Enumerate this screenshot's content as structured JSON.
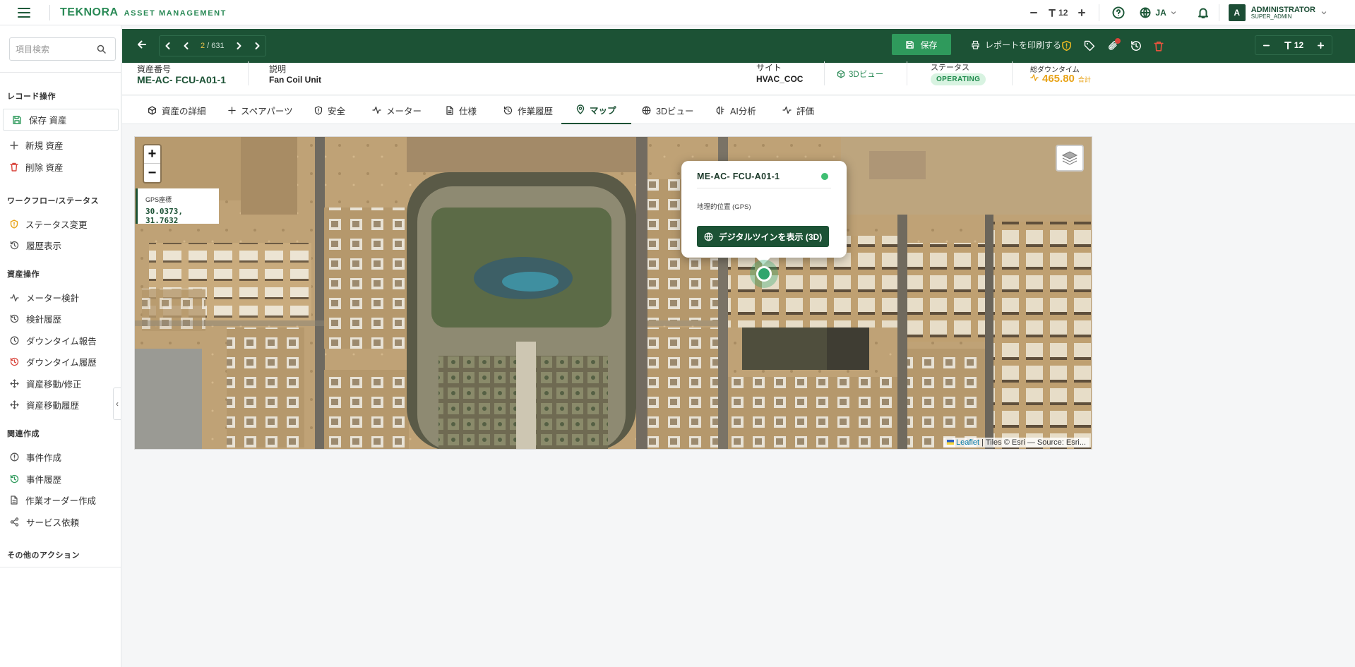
{
  "app": {
    "logo": "TEKNORA",
    "subtitle": "ASSET MANAGEMENT"
  },
  "topbar": {
    "font_size": "12",
    "lang": "JA",
    "user_initial": "A",
    "user_name": "ADMINISTRATOR",
    "user_role": "SUPER_ADMIN"
  },
  "sidebar": {
    "search_placeholder": "項目検索",
    "sections": {
      "record": "レコード操作",
      "workflow": "ワークフロー/ステータス",
      "asset": "資産操作",
      "related": "関連作成",
      "other": "その他のアクション"
    },
    "items": {
      "save": "保存 資産",
      "new": "新規 資産",
      "delete": "削除 資産",
      "status_change": "ステータス変更",
      "history": "履歴表示",
      "meter_reading": "メーター検針",
      "reading_history": "検針履歴",
      "downtime_report": "ダウンタイム報告",
      "downtime_history": "ダウンタイム履歴",
      "move": "資産移動/修正",
      "move_history": "資産移動履歴",
      "incident_create": "事件作成",
      "incident_history": "事件履歴",
      "work_order": "作業オーダー作成",
      "service_request": "サービス依頼"
    }
  },
  "toolbar": {
    "current_page": "2",
    "total_pages": "631",
    "save_label": "保存",
    "print_label": "レポートを印刷する",
    "font_size": "12"
  },
  "header": {
    "asset_no_label": "資産番号",
    "asset_no": "ME-AC- FCU-A01-1",
    "desc_label": "説明",
    "desc": "Fan Coil Unit",
    "site_label": "サイト",
    "site": "HVAC_COC",
    "view3d": "3Dビュー",
    "status_label": "ステータス",
    "status": "OPERATING",
    "downtime_label": "総ダウンタイム",
    "downtime_value": "465.80",
    "downtime_unit": "合計"
  },
  "tabs": [
    "資産の詳細",
    "スペアパーツ",
    "安全",
    "メーター",
    "仕様",
    "作業履歴",
    "マップ",
    "3Dビュー",
    "AI分析",
    "評価"
  ],
  "active_tab": "マップ",
  "map": {
    "gps_label": "GPS座標",
    "gps_value": "30.0373, 31.7632",
    "popup_title": "ME-AC- FCU-A01-1",
    "popup_location": "地理的位置 (GPS)",
    "popup_button": "デジタルツインを表示 (3D)",
    "attribution_leaflet": "Leaflet",
    "attribution_rest": "| Tiles © Esri — Source: Esri..."
  },
  "colors": {
    "brand_green": "#1c5235",
    "accent_green": "#2f9a5c",
    "status_bg": "#d8f3e1",
    "downtime": "#e8a317"
  }
}
